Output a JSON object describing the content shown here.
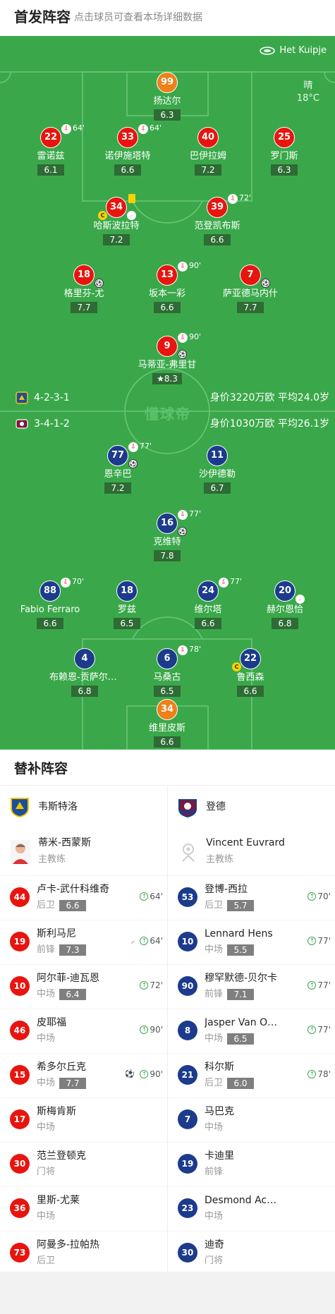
{
  "header": {
    "title": "首发阵容",
    "subtitle": "点击球员可查看本场详细数据"
  },
  "venue": {
    "name": "Het Kuipje",
    "weather": "晴",
    "temperature": "18°C"
  },
  "watermark": "懂球帝",
  "home": {
    "formation": "4-2-3-1",
    "value_text": "身价3220万欧 平均24.0岁",
    "team_name": "韦斯特洛",
    "players": [
      {
        "number": "99",
        "name": "扬达尔",
        "rating": "6.3",
        "role": "gk"
      },
      {
        "number": "22",
        "name": "雷诺兹",
        "rating": "6.1",
        "sub_minute": "64'"
      },
      {
        "number": "33",
        "name": "诺伊施塔特",
        "rating": "6.6",
        "sub_minute": "64'"
      },
      {
        "number": "40",
        "name": "巴伊拉姆",
        "rating": "7.2"
      },
      {
        "number": "25",
        "name": "罗门斯",
        "rating": "6.3"
      },
      {
        "number": "34",
        "name": "哈斯波拉特",
        "rating": "7.2",
        "captain": "C"
      },
      {
        "number": "39",
        "name": "范登凯布斯",
        "rating": "6.6",
        "sub_minute": "72'"
      },
      {
        "number": "18",
        "name": "格里芬-尤",
        "rating": "7.7"
      },
      {
        "number": "13",
        "name": "坂本一彩",
        "rating": "6.6",
        "sub_minute": "90'"
      },
      {
        "number": "7",
        "name": "萨亚德马内什",
        "rating": "7.7"
      },
      {
        "number": "9",
        "name": "马蒂亚-弗里甘",
        "rating": "8.3",
        "sub_minute": "90'",
        "mvp": true
      }
    ],
    "coach": {
      "name": "蒂米-西蒙斯",
      "role": "主教练"
    },
    "subs": [
      {
        "number": "44",
        "name": "卢卡-武什科维奇",
        "pos": "后卫",
        "rating": "6.6",
        "minute": "64'"
      },
      {
        "number": "19",
        "name": "斯利马尼",
        "pos": "前锋",
        "rating": "7.3",
        "minute": "64'",
        "extra": "assist"
      },
      {
        "number": "10",
        "name": "阿尔菲-迪瓦恩",
        "pos": "中场",
        "rating": "6.4",
        "minute": "72'"
      },
      {
        "number": "46",
        "name": "皮耶福",
        "pos": "中场",
        "rating": "",
        "minute": "90'"
      },
      {
        "number": "15",
        "name": "希多尔丘克",
        "pos": "中场",
        "rating": "7.7",
        "minute": "90'",
        "extra": "goal"
      },
      {
        "number": "17",
        "name": "斯梅肯斯",
        "pos": "中场",
        "rating": "",
        "minute": ""
      },
      {
        "number": "30",
        "name": "范兰登顿克",
        "pos": "门将",
        "rating": "",
        "minute": ""
      },
      {
        "number": "36",
        "name": "里斯-尤莱",
        "pos": "中场",
        "rating": "",
        "minute": ""
      },
      {
        "number": "73",
        "name": "阿曼多-拉帕热",
        "pos": "后卫",
        "rating": "",
        "minute": ""
      }
    ]
  },
  "away": {
    "formation": "3-4-1-2",
    "value_text": "身价1030万欧 平均26.1岁",
    "team_name": "登德",
    "players": [
      {
        "number": "77",
        "name": "恩辛巴",
        "rating": "7.2",
        "sub_minute": "77'"
      },
      {
        "number": "11",
        "name": "沙伊德勒",
        "rating": "6.7"
      },
      {
        "number": "16",
        "name": "克维特",
        "rating": "7.8",
        "sub_minute": "77'"
      },
      {
        "number": "88",
        "name": "Fabio Ferraro",
        "rating": "6.6",
        "sub_minute": "70'"
      },
      {
        "number": "18",
        "name": "罗兹",
        "rating": "6.5"
      },
      {
        "number": "24",
        "name": "维尔塔",
        "rating": "6.6",
        "sub_minute": "77'"
      },
      {
        "number": "20",
        "name": "赫尔恩恰",
        "rating": "6.8"
      },
      {
        "number": "4",
        "name": "布赖恩-贡萨尔维斯",
        "rating": "6.8"
      },
      {
        "number": "6",
        "name": "马桑古",
        "rating": "6.5",
        "sub_minute": "78'"
      },
      {
        "number": "22",
        "name": "鲁西森",
        "rating": "6.6",
        "captain": "C"
      },
      {
        "number": "34",
        "name": "维里皮斯",
        "rating": "6.6",
        "role": "gk"
      }
    ],
    "coach": {
      "name": "Vincent Euvrard",
      "role": "主教练"
    },
    "subs": [
      {
        "number": "53",
        "name": "登博-西拉",
        "pos": "后卫",
        "rating": "5.7",
        "minute": "70'"
      },
      {
        "number": "10",
        "name": "Lennard Hens",
        "pos": "中场",
        "rating": "5.5",
        "minute": "77'"
      },
      {
        "number": "90",
        "name": "穆罕默德-贝尔卡",
        "pos": "前锋",
        "rating": "7.1",
        "minute": "77'"
      },
      {
        "number": "8",
        "name": "Jasper Van Oudenhove",
        "pos": "中场",
        "rating": "6.5",
        "minute": "77'"
      },
      {
        "number": "21",
        "name": "科尔斯",
        "pos": "后卫",
        "rating": "6.0",
        "minute": "78'"
      },
      {
        "number": "7",
        "name": "马巴克",
        "pos": "中场",
        "rating": "",
        "minute": ""
      },
      {
        "number": "19",
        "name": "卡迪里",
        "pos": "前锋",
        "rating": "",
        "minute": ""
      },
      {
        "number": "23",
        "name": "Desmond Acquah",
        "pos": "中场",
        "rating": "",
        "minute": ""
      },
      {
        "number": "30",
        "name": "迪奇",
        "pos": "门将",
        "rating": "",
        "minute": ""
      }
    ]
  },
  "subs_section": {
    "title": "替补阵容"
  },
  "colors": {
    "pitch": "#3aa84a",
    "home": "#e8150f",
    "away": "#1c3b8c",
    "gk": "#f08018"
  }
}
